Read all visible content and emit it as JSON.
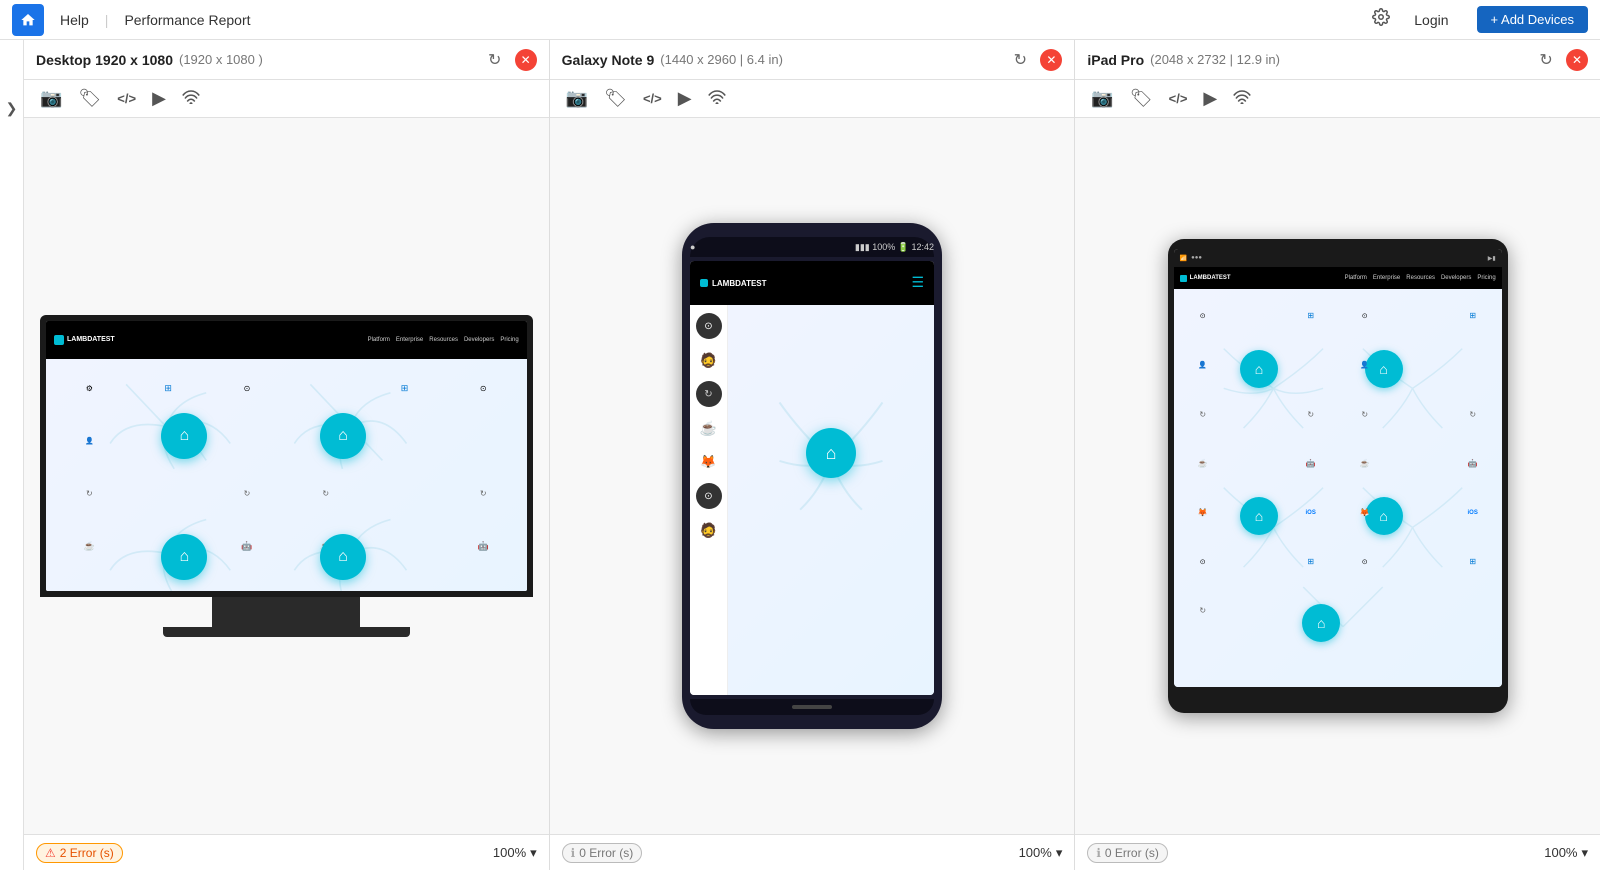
{
  "topnav": {
    "home_icon": "🏠",
    "help_label": "Help",
    "separator": "|",
    "report_label": "Performance Report",
    "login_label": "Login",
    "add_devices_label": "+ Add Devices"
  },
  "sidebar": {
    "toggle_icon": "❯"
  },
  "panels": [
    {
      "id": "desktop",
      "title_main": "Desktop 1920 x 1080",
      "title_dim": "(1920 x 1080 )",
      "type": "desktop",
      "errors": "2 Error (s)",
      "error_type": "error",
      "zoom": "100%"
    },
    {
      "id": "galaxy",
      "title_main": "Galaxy Note 9",
      "title_dim": "(1440 x 2960 | 6.4 in)",
      "type": "phone",
      "errors": "0 Error (s)",
      "error_type": "info",
      "zoom": "100%"
    },
    {
      "id": "ipad",
      "title_main": "iPad Pro",
      "title_dim": "(2048 x 2732 | 12.9 in)",
      "type": "tablet",
      "errors": "0 Error (s)",
      "error_type": "info",
      "zoom": "100%"
    }
  ]
}
